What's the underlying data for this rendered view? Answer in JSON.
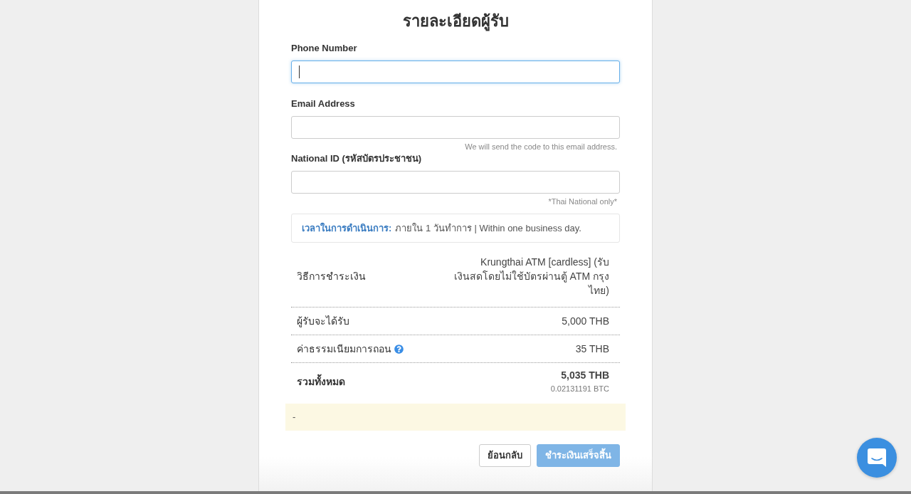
{
  "title": "รายละเอียดผู้รับ",
  "fields": [
    {
      "label": "Phone Number",
      "focused": true
    },
    {
      "label": "Email Address",
      "focused": false,
      "hint": "We will send the code to this email address."
    },
    {
      "label": "National ID (รหัสบัตรประชาชน)",
      "focused": false,
      "hint": "*Thai National only*"
    }
  ],
  "processing_time": {
    "label": "เวลาในการดำเนินการ:",
    "value": "ภายใน 1 วันทำการ | Within one business day."
  },
  "summary": [
    {
      "kind": "item",
      "label": "วิธีการชำระเงิน",
      "value": "Krungthai ATM [cardless] (รับเงินสดโดยไม่ใช้บัตรผ่านตู้ ATM กรุงไทย)",
      "help": false
    },
    {
      "kind": "item",
      "label": "ผู้รับจะได้รับ",
      "value": "5,000 THB",
      "help": false
    },
    {
      "kind": "item",
      "label": "ค่าธรรมเนียมการถอน",
      "value": "35 THB",
      "help": true
    },
    {
      "kind": "total",
      "label": "รวมทั้งหมด",
      "value": "5,035 THB",
      "sub_value": "0.02131191 BTC",
      "help": false
    }
  ],
  "notice": "-",
  "buttons": [
    {
      "kind": "secondary",
      "label": "ย้อนกลับ",
      "disabled": false
    },
    {
      "kind": "primary",
      "label": "ชำระเงินเสร็จสิ้น",
      "disabled": true
    }
  ]
}
